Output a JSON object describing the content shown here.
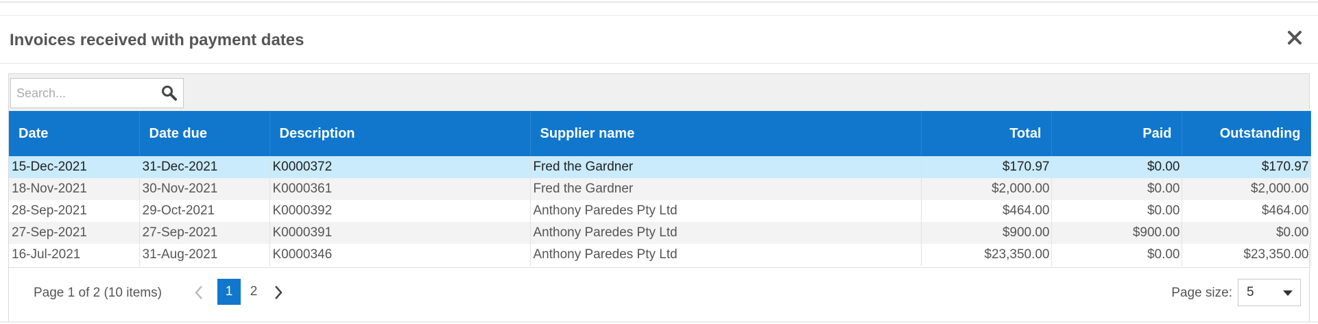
{
  "dialog": {
    "title": "Invoices received with payment dates"
  },
  "search": {
    "placeholder": "Search..."
  },
  "table": {
    "columns": [
      "Date",
      "Date due",
      "Description",
      "Supplier name",
      "Total",
      "Paid",
      "Outstanding"
    ],
    "rows": [
      [
        "15-Dec-2021",
        "31-Dec-2021",
        "K0000372",
        "Fred the Gardner",
        "$170.97",
        "$0.00",
        "$170.97"
      ],
      [
        "18-Nov-2021",
        "30-Nov-2021",
        "K0000361",
        "Fred the Gardner",
        "$2,000.00",
        "$0.00",
        "$2,000.00"
      ],
      [
        "28-Sep-2021",
        "29-Oct-2021",
        "K0000392",
        "Anthony Paredes Pty Ltd",
        "$464.00",
        "$0.00",
        "$464.00"
      ],
      [
        "27-Sep-2021",
        "27-Sep-2021",
        "K0000391",
        "Anthony Paredes Pty Ltd",
        "$900.00",
        "$900.00",
        "$0.00"
      ],
      [
        "16-Jul-2021",
        "31-Aug-2021",
        "K0000346",
        "Anthony Paredes Pty Ltd",
        "$23,350.00",
        "$0.00",
        "$23,350.00"
      ]
    ]
  },
  "pager": {
    "info": "Page 1 of 2 (10 items)",
    "pages": [
      "1",
      "2"
    ],
    "current_page": "1",
    "page_size_label": "Page size:",
    "page_size_value": "5"
  },
  "colors": {
    "header_blue": "#1177cc",
    "selected_row": "#c9ebfb"
  }
}
